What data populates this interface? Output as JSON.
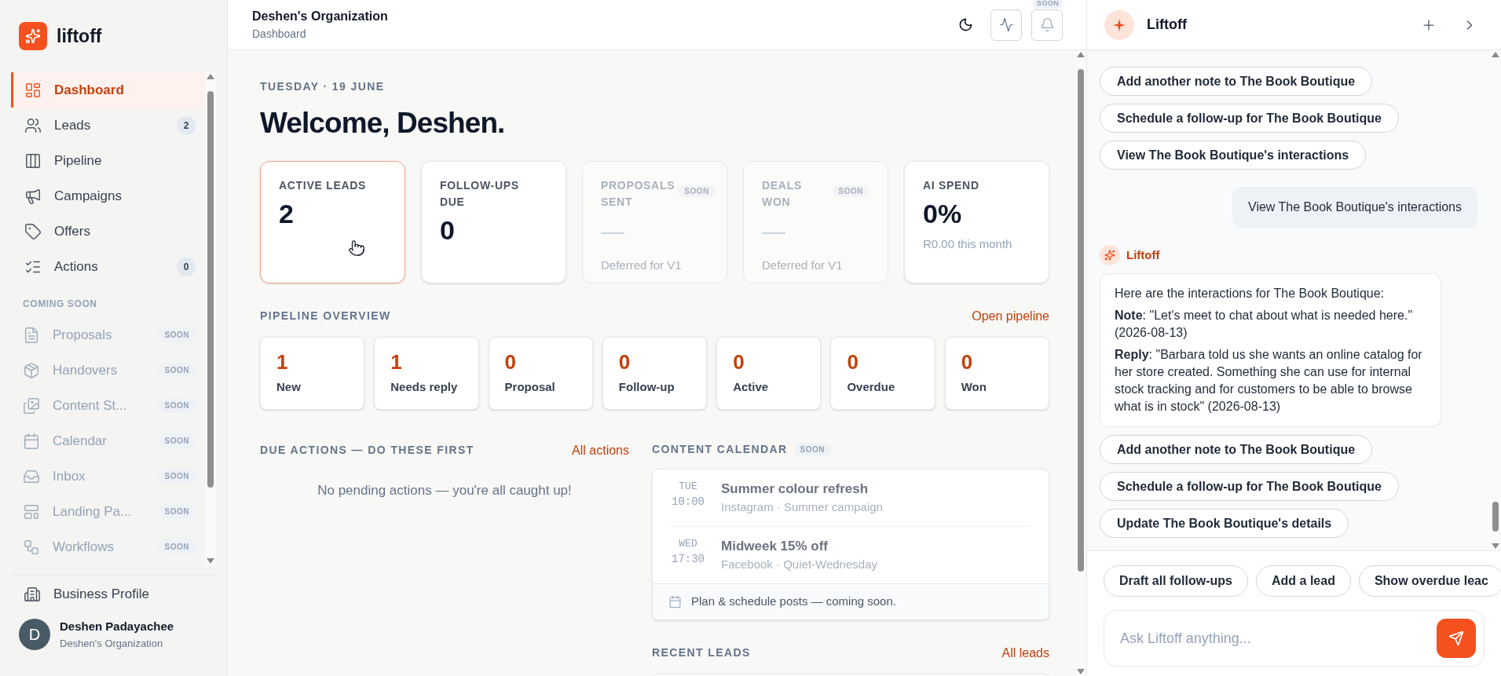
{
  "brand": {
    "name": "liftoff"
  },
  "sidebar": {
    "nav": [
      {
        "label": "Dashboard",
        "selected": true
      },
      {
        "label": "Leads",
        "selected": false,
        "badge": "2"
      },
      {
        "label": "Pipeline",
        "selected": false
      },
      {
        "label": "Campaigns",
        "selected": false
      },
      {
        "label": "Offers",
        "selected": false
      },
      {
        "label": "Actions",
        "selected": false,
        "badge": "0"
      }
    ],
    "section_label": "COMING SOON",
    "coming_soon": [
      {
        "label": "Proposals",
        "badge": "SOON",
        "disabled": true
      },
      {
        "label": "Handovers",
        "badge": "SOON",
        "disabled": true
      },
      {
        "label": "Content St...",
        "badge": "SOON",
        "disabled": true
      },
      {
        "label": "Calendar",
        "badge": "SOON",
        "disabled": true
      },
      {
        "label": "Inbox",
        "badge": "SOON",
        "disabled": true
      },
      {
        "label": "Landing Pa...",
        "badge": "SOON",
        "disabled": true
      },
      {
        "label": "Workflows",
        "badge": "SOON",
        "disabled": true
      }
    ],
    "footer_link": "Business Profile",
    "user": {
      "initial": "D",
      "name": "Deshen Padayachee",
      "org": "Deshen's Organization"
    }
  },
  "header": {
    "title": "Deshen's Organization",
    "subtitle": "Dashboard",
    "bell_badge": "SOON"
  },
  "dashboard": {
    "date": "TUESDAY · 19 JUNE",
    "greeting": "Welcome, Deshen.",
    "stats": [
      {
        "label": "ACTIVE LEADS",
        "value": "2",
        "disabled": false,
        "selected": true
      },
      {
        "label": "FOLLOW-UPS DUE",
        "value": "0",
        "disabled": false,
        "selected": false
      },
      {
        "label": "PROPOSALS SENT",
        "value": "—",
        "sublabel": "Deferred for V1",
        "badge": "SOON",
        "disabled": true,
        "selected": false
      },
      {
        "label": "DEALS WON",
        "value": "—",
        "sublabel": "Deferred for V1",
        "badge": "SOON",
        "disabled": true,
        "selected": false
      },
      {
        "label": "AI SPEND",
        "value": "0%",
        "sublabel": "R0.00 this month",
        "disabled": false,
        "selected": false
      }
    ],
    "pipeline": {
      "title": "PIPELINE OVERVIEW",
      "link": "Open pipeline",
      "stages": [
        {
          "count": "1",
          "label": "New"
        },
        {
          "count": "1",
          "label": "Needs reply"
        },
        {
          "count": "0",
          "label": "Proposal"
        },
        {
          "count": "0",
          "label": "Follow-up"
        },
        {
          "count": "0",
          "label": "Active"
        },
        {
          "count": "0",
          "label": "Overdue"
        },
        {
          "count": "0",
          "label": "Won"
        }
      ]
    },
    "due_actions": {
      "title": "DUE ACTIONS — DO THESE FIRST",
      "link": "All actions",
      "empty": "No pending actions — you're all caught up!"
    },
    "calendar": {
      "title": "CONTENT CALENDAR",
      "badge": "SOON",
      "posts": [
        {
          "day": "TUE",
          "time": "10:00",
          "title": "Summer colour refresh",
          "meta": "Instagram · Summer campaign"
        },
        {
          "day": "WED",
          "time": "17:30",
          "title": "Midweek 15% off",
          "meta": "Facebook · Quiet-Wednesday"
        }
      ],
      "footer": "Plan & schedule posts — coming soon."
    },
    "recent_leads": {
      "title": "RECENT LEADS",
      "link": "All leads"
    }
  },
  "assistant": {
    "title": "Liftoff",
    "messages": [
      {
        "kind": "suggestions",
        "items": [
          "Add another note to The Book Boutique",
          "Schedule a follow-up for The Book Boutique",
          "View The Book Boutique's interactions"
        ]
      },
      {
        "kind": "user",
        "text": "View The Book Boutique's interactions"
      },
      {
        "kind": "assistant",
        "author": "Liftoff",
        "paragraphs": [
          "Here are the interactions for The Book Boutique:",
          "**Note**: \"Let's meet to chat about what is needed here.\" (2026-08-13)",
          "**Reply**: \"Barbara told us she wants an online catalog for her store created. Something she can use for internal stock tracking and for customers to be able to browse what is in stock\" (2026-08-13)"
        ]
      },
      {
        "kind": "suggestions",
        "items": [
          "Add another note to The Book Boutique",
          "Schedule a follow-up for The Book Boutique",
          "Update The Book Boutique's details"
        ]
      }
    ],
    "quick_actions": [
      "Draft all follow-ups",
      "Add a lead",
      "Show overdue leac"
    ],
    "input": {
      "placeholder": "Ask Liftoff anything..."
    }
  }
}
